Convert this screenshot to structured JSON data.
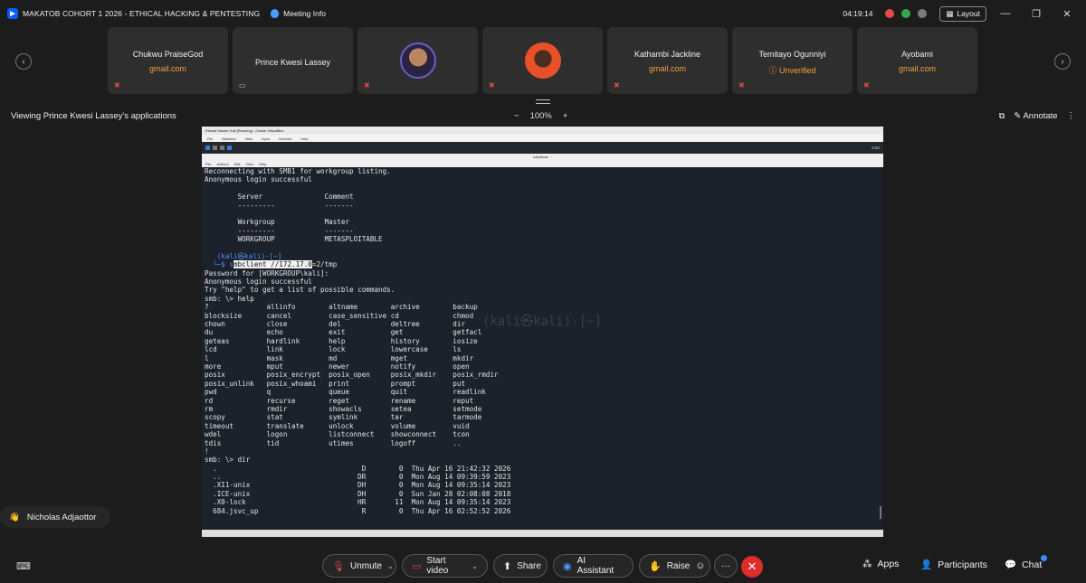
{
  "window": {
    "meeting_title": "MAKATOB COHORT 1 2026 - ETHICAL HACKING & PENTESTING",
    "meeting_info": "Meeting Info",
    "timer": "04:19:14",
    "layout_label": "Layout",
    "min_glyph": "—",
    "max_glyph": "❐",
    "close_glyph": "✕"
  },
  "participants": [
    {
      "name": "Chukwu PraiseGod",
      "email": "gmail.com"
    },
    {
      "name": "Prince Kwesi Lassey"
    },
    {
      "name": ""
    },
    {
      "name": ""
    },
    {
      "name": "Kathambi Jackline",
      "email": "gmail.com"
    },
    {
      "name": "Temitayo Ogunniyi",
      "email": "ⓘ Unverified"
    },
    {
      "name": "Ayobami",
      "email": "gmail.com"
    }
  ],
  "share": {
    "viewing": "Viewing Prince Kwesi Lassey's applications",
    "zoom_out": "−",
    "zoom": "100%",
    "zoom_in": "+",
    "annotate": "Annotate",
    "more": "⋮"
  },
  "vbox": {
    "title": "Ethical Hacker Kali [Running] - Oracle VirtualBox",
    "menu": [
      "File",
      "Machine",
      "View",
      "Input",
      "Devices",
      "Help"
    ],
    "panel_time": "2:52",
    "term_title": "kali@kali: ~",
    "term_menu": [
      "File",
      "Actions",
      "Edit",
      "View",
      "Help"
    ]
  },
  "terminal": {
    "lines": [
      "Reconnecting with SMB1 for workgroup listing.",
      "Anonymous login successful",
      "",
      "        Server               Comment",
      "        ---------            -------",
      "",
      "        Workgroup            Master",
      "        ---------            -------",
      "        WORKGROUP            METASPLOITABLE",
      "",
      "   (kali㉿kali)-[~]",
      "__PROMPT__",
      "Password for [WORKGROUP\\kali]:",
      "Anonymous login successful",
      "Try \"help\" to get a list of possible commands.",
      "smb: \\> help",
      "?              allinfo        altname        archive        backup",
      "blocksize      cancel         case_sensitive cd             chmod",
      "chown          close          del            deltree        dir",
      "du             echo           exit           get            getfacl",
      "geteas         hardlink       help           history        iosize",
      "lcd            link           lock           lowercase      ls",
      "l              mask           md             mget           mkdir",
      "more           mput           newer          notify         open",
      "posix          posix_encrypt  posix_open     posix_mkdir    posix_rmdir",
      "posix_unlink   posix_whoami   print          prompt         put",
      "pwd            q              queue          quit           readlink",
      "rd             recurse        reget          rename         reput",
      "rm             rmdir          showacls       setea          setmode",
      "scopy          stat           symlink        tar            tarmode",
      "timeout        translate      unlock         volume         vuid",
      "wdel           logon          listconnect    showconnect    tcon",
      "tdis           tid            utimes         logoff         ..",
      "!",
      "smb: \\> dir",
      "  .                                   D        0  Thu Apr 16 21:42:32 2026",
      "  ..                                 DR        0  Mon Aug 14 09:39:59 2023",
      "  .X11-unix                          DH        0  Mon Aug 14 09:35:14 2023",
      "  .ICE-unix                          DH        0  Sun Jan 28 02:08:08 2018",
      "  .X0-lock                           HR       11  Mon Aug 14 09:35:14 2023",
      "  684.jsvc_up                         R        0  Thu Apr 16 02:52:52 2026"
    ],
    "prompt_prefix": "  └─$ s",
    "prompt_highlight": "mbclient //172.17.0",
    "prompt_suffix": "=2/tmp",
    "watermark": "(kali㉿kali)-[~]"
  },
  "reaction": {
    "emoji": "👋",
    "name": "Nicholas Adjaottor"
  },
  "toolbar": {
    "unmute": "Unmute",
    "start_video": "Start video",
    "share": "Share",
    "ai": "AI Assistant",
    "raise": "Raise",
    "more": "···",
    "end": "✕",
    "apps": "Apps",
    "participants": "Participants",
    "chat": "Chat"
  }
}
